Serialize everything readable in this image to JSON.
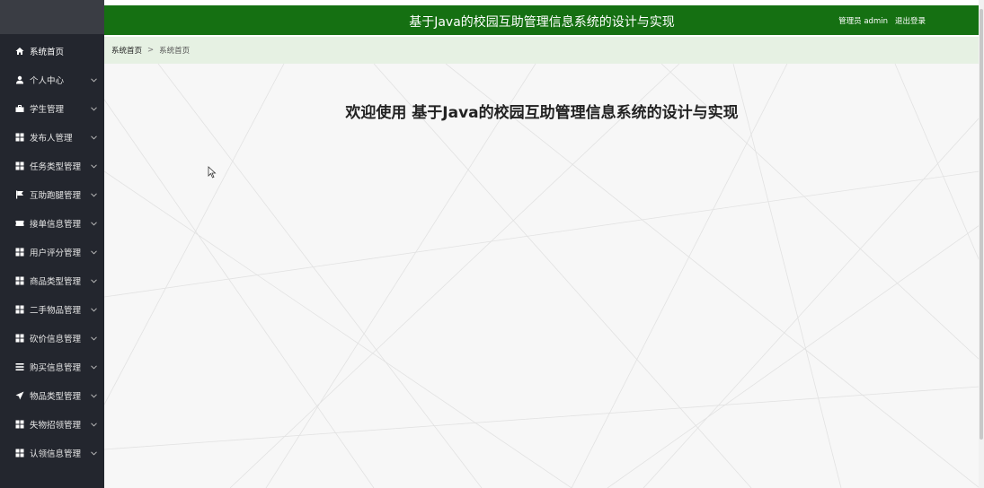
{
  "header": {
    "title": "基于Java的校园互助管理信息系统的设计与实现",
    "user_label": "管理员 admin",
    "logout_label": "退出登录"
  },
  "breadcrumb": {
    "home": "系统首页",
    "separator": ">",
    "current": "系统首页"
  },
  "main": {
    "welcome": "欢迎使用 基于Java的校园互助管理信息系统的设计与实现"
  },
  "sidebar": {
    "items": [
      {
        "label": "系统首页",
        "icon": "home-icon",
        "has_submenu": false
      },
      {
        "label": "个人中心",
        "icon": "user-icon",
        "has_submenu": true
      },
      {
        "label": "学生管理",
        "icon": "briefcase-icon",
        "has_submenu": true
      },
      {
        "label": "发布人管理",
        "icon": "grid-icon",
        "has_submenu": true
      },
      {
        "label": "任务类型管理",
        "icon": "grid-icon",
        "has_submenu": true
      },
      {
        "label": "互助跑腿管理",
        "icon": "flag-icon",
        "has_submenu": true
      },
      {
        "label": "接单信息管理",
        "icon": "ticket-icon",
        "has_submenu": true
      },
      {
        "label": "用户评分管理",
        "icon": "grid-icon",
        "has_submenu": true
      },
      {
        "label": "商品类型管理",
        "icon": "grid-icon",
        "has_submenu": true
      },
      {
        "label": "二手物品管理",
        "icon": "grid-icon",
        "has_submenu": true
      },
      {
        "label": "砍价信息管理",
        "icon": "grid-icon",
        "has_submenu": true
      },
      {
        "label": "购买信息管理",
        "icon": "list-icon",
        "has_submenu": true
      },
      {
        "label": "物品类型管理",
        "icon": "send-icon",
        "has_submenu": true
      },
      {
        "label": "失物招领管理",
        "icon": "grid-icon",
        "has_submenu": true
      },
      {
        "label": "认领信息管理",
        "icon": "grid-icon",
        "has_submenu": true
      }
    ]
  },
  "colors": {
    "header_bg": "#157012",
    "sidebar_bg": "#23262e",
    "breadcrumb_bg": "#e6f1e3"
  }
}
